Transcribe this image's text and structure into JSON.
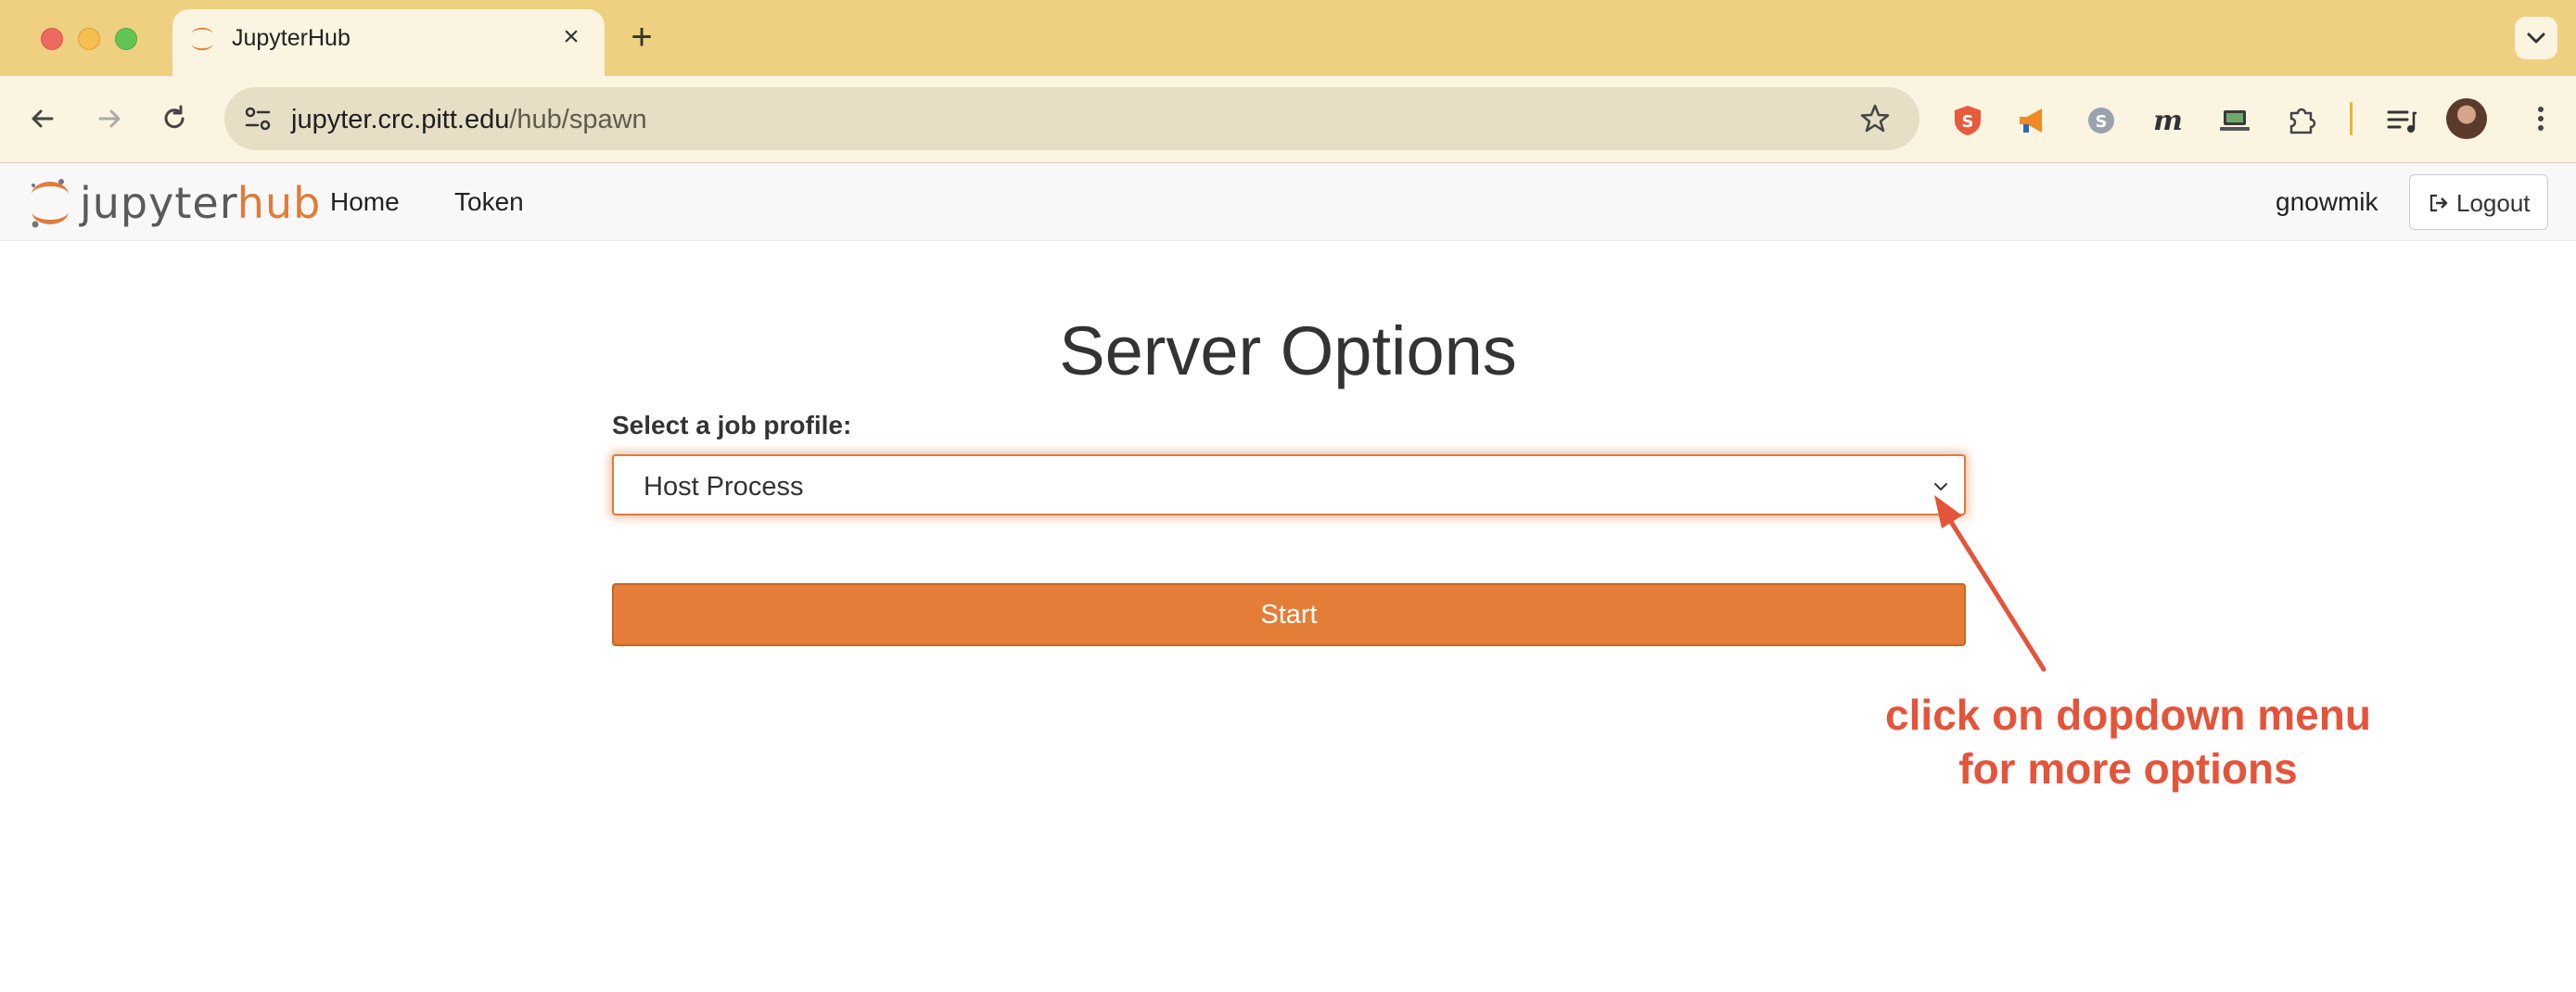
{
  "browser": {
    "tab_title": "JupyterHub",
    "url_host": "jupyter.crc.pitt.edu",
    "url_path": "/hub/spawn",
    "extensions": [
      "s-shield-extension-icon",
      "megaphone-extension-icon",
      "skype-extension-icon",
      "m-extension-icon",
      "laptop-extension-icon",
      "puzzle-extensions-icon",
      "media-queue-icon"
    ]
  },
  "hub": {
    "logo_jupyter": "jupyter",
    "logo_hub": "hub",
    "nav": {
      "home": "Home",
      "token": "Token"
    },
    "username": "gnowmik",
    "logout": "Logout"
  },
  "spawn": {
    "title": "Server Options",
    "profile_label": "Select a job profile:",
    "profile_selected": "Host Process",
    "start_label": "Start"
  },
  "annotation": {
    "line1": "click on dopdown menu",
    "line2": "for more options",
    "color": "#e4543b"
  },
  "colors": {
    "accent": "#e37d37",
    "tabbar": "#efcf80",
    "toolbar": "#fbf4e1"
  }
}
